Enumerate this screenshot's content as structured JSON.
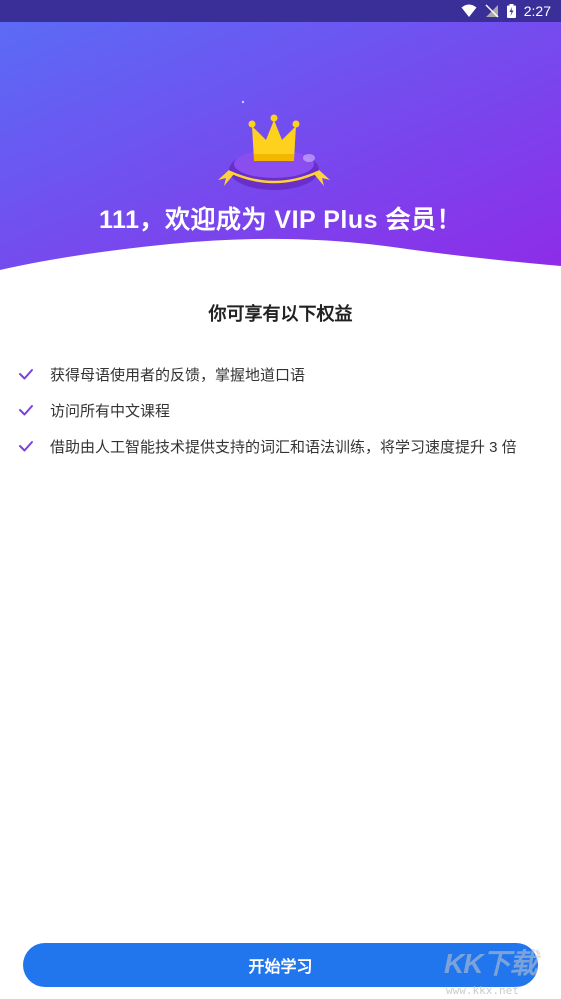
{
  "status_bar": {
    "time": "2:27"
  },
  "hero": {
    "title": "111，欢迎成为 VIP Plus 会员！"
  },
  "benefits": {
    "heading": "你可享有以下权益",
    "items": [
      {
        "label": "获得母语使用者的反馈，掌握地道口语"
      },
      {
        "label": "访问所有中文课程"
      },
      {
        "label": "借助由人工智能技术提供支持的词汇和语法训练，将学习速度提升 3 倍"
      }
    ]
  },
  "footer": {
    "start_label": "开始学习"
  },
  "watermark": {
    "logo": "KK下载",
    "url": "www.kkx.net"
  },
  "colors": {
    "gradient_start": "#5b6bf5",
    "gradient_end": "#8e2ce8",
    "check": "#7b3fe4",
    "button": "#2176ee"
  }
}
